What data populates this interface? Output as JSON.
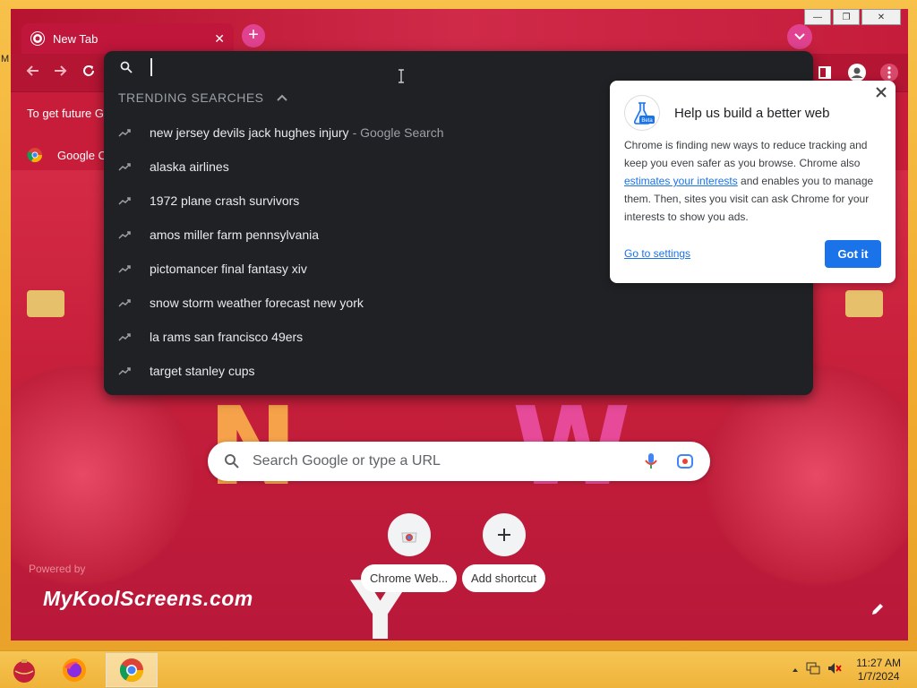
{
  "window": {
    "tab_title": "New Tab",
    "tab_close": "✕",
    "new_tab": "+",
    "controls": {
      "minimize": "—",
      "maximize": "❐",
      "close": "✕"
    }
  },
  "toolbar": {
    "back_icon": "arrow-left",
    "forward_icon": "arrow-right",
    "reload_icon": "reload"
  },
  "infobar": {
    "text": "To get future G"
  },
  "bookmarks": {
    "item_label": "Google C"
  },
  "omnibox": {
    "input_value": "",
    "trending_header": "TRENDING SEARCHES",
    "suggestions": [
      {
        "text": "new jersey devils jack hughes injury",
        "extra": "- Google Search"
      },
      {
        "text": "alaska airlines",
        "extra": ""
      },
      {
        "text": "1972 plane crash survivors",
        "extra": ""
      },
      {
        "text": "amos miller farm pennsylvania",
        "extra": ""
      },
      {
        "text": "pictomancer final fantasy xiv",
        "extra": ""
      },
      {
        "text": "snow storm weather forecast new york",
        "extra": ""
      },
      {
        "text": "la rams san francisco 49ers",
        "extra": ""
      },
      {
        "text": "target stanley cups",
        "extra": ""
      }
    ]
  },
  "promo": {
    "title": "Help us build a better web",
    "badge": "Beta",
    "body_part1": "Chrome is finding new ways to reduce tracking and keep you even safer as you browse. Chrome also ",
    "body_link": "estimates your interests",
    "body_part2": " and enables you to manage them. Then, sites you visit can ask Chrome for your interests to show you ads.",
    "settings_link": "Go to settings",
    "got_it": "Got it"
  },
  "ntp": {
    "search_placeholder": "Search Google or type a URL",
    "shortcuts": [
      {
        "label": "Chrome Web..."
      },
      {
        "label": "Add shortcut"
      }
    ],
    "powered_by": "Powered by",
    "brand": "MyKoolScreens.com"
  },
  "taskbar": {
    "time": "11:27 AM",
    "date": "1/7/2024"
  },
  "colors": {
    "accent": "#1a73e8",
    "omnibox_bg": "#202124",
    "frame": "#c81d3a",
    "taskbar": "#f2b840"
  }
}
